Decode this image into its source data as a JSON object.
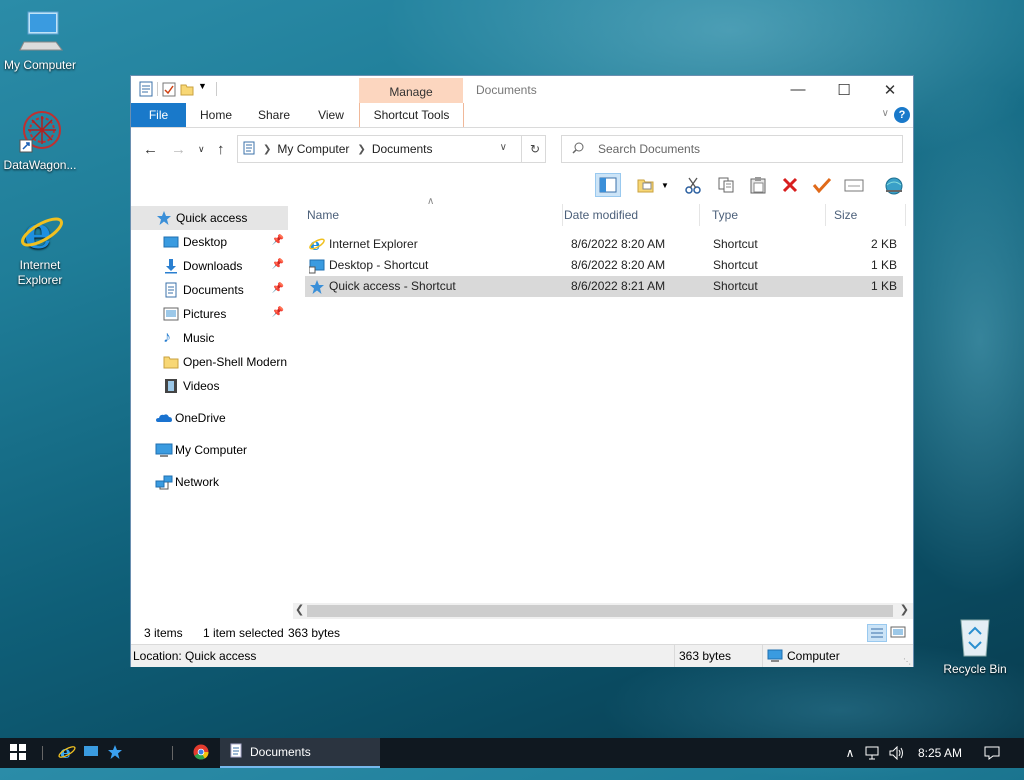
{
  "desktop": {
    "icons": [
      {
        "label": "My Computer"
      },
      {
        "label": "DataWagon..."
      },
      {
        "label": "Internet Explorer"
      },
      {
        "label": "Recycle Bin"
      }
    ]
  },
  "window": {
    "title": "Documents",
    "context_tab_group": "Manage",
    "tabs": [
      "File",
      "Home",
      "Share",
      "View",
      "Shortcut Tools"
    ],
    "help": "?",
    "address": {
      "crumbs": [
        "My Computer",
        "Documents"
      ]
    },
    "search": {
      "placeholder": "Search Documents"
    },
    "navpane": {
      "items": [
        {
          "label": "Quick access",
          "icon": "quick-access-star-icon"
        },
        {
          "label": "Desktop",
          "icon": "desktop-icon"
        },
        {
          "label": "Downloads",
          "icon": "downloads-icon"
        },
        {
          "label": "Documents",
          "icon": "documents-icon"
        },
        {
          "label": "Pictures",
          "icon": "pictures-icon"
        },
        {
          "label": "Music",
          "icon": "music-icon"
        },
        {
          "label": "Open-Shell Modern",
          "icon": "folder-icon"
        },
        {
          "label": "Videos",
          "icon": "videos-icon"
        },
        {
          "label": "OneDrive",
          "icon": "onedrive-icon"
        },
        {
          "label": "My Computer",
          "icon": "computer-icon"
        },
        {
          "label": "Network",
          "icon": "network-icon"
        }
      ]
    },
    "columns": {
      "name": "Name",
      "date": "Date modified",
      "type": "Type",
      "size": "Size"
    },
    "files": [
      {
        "name": "Internet Explorer",
        "date": "8/6/2022 8:20 AM",
        "type": "Shortcut",
        "size": "2 KB"
      },
      {
        "name": "Desktop - Shortcut",
        "date": "8/6/2022 8:20 AM",
        "type": "Shortcut",
        "size": "1 KB"
      },
      {
        "name": "Quick access - Shortcut",
        "date": "8/6/2022 8:21 AM",
        "type": "Shortcut",
        "size": "1 KB"
      }
    ],
    "status": {
      "count": "3 items",
      "selected": "1 item selected",
      "bytes": "363 bytes"
    },
    "details": {
      "location": "Location: Quick access",
      "bytes": "363 bytes",
      "zone": "Computer"
    }
  },
  "taskbar": {
    "active_app": "Documents",
    "clock": "8:25 AM"
  },
  "colors": {
    "accent": "#1979ca",
    "manage_tab": "#fcd6bf",
    "selection": "#d9d9d9",
    "taskbar": "#101820"
  }
}
